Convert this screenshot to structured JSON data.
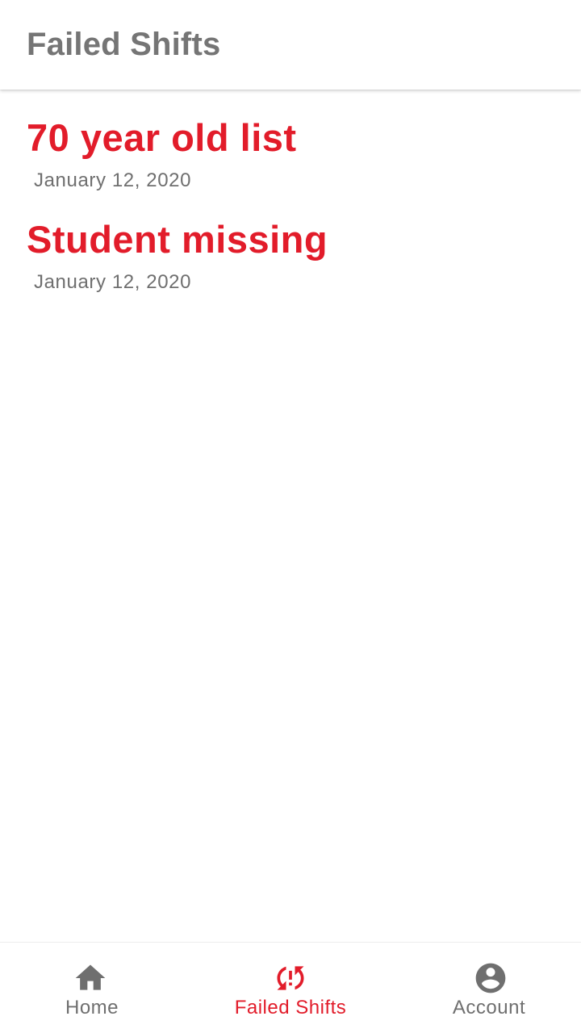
{
  "app_bar": {
    "title": "Failed Shifts"
  },
  "shifts": [
    {
      "title": "70 year old list",
      "date": "January 12, 2020"
    },
    {
      "title": "Student missing",
      "date": "January 12, 2020"
    }
  ],
  "bottom_nav": {
    "items": [
      {
        "label": "Home",
        "icon": "home-icon",
        "active": false
      },
      {
        "label": "Failed Shifts",
        "icon": "sync-problem-icon",
        "active": true
      },
      {
        "label": "Account",
        "icon": "account-circle-icon",
        "active": false
      }
    ]
  },
  "colors": {
    "accent": "#e21c2a",
    "inactive": "#6f6f6f",
    "title_gray": "#757575"
  }
}
